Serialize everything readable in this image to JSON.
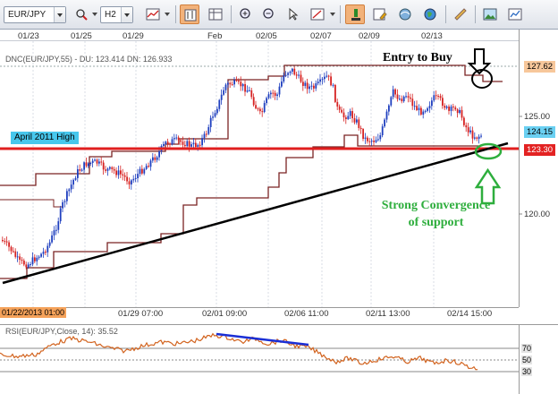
{
  "toolbar": {
    "symbol": "EUR/JPY",
    "timeframe": "H2",
    "icons": [
      "crosshair-zoom-icon",
      "bar-chart-icon",
      "candlestick-toggle-icon",
      "chart-table-icon",
      "zoom-in-icon",
      "zoom-out-icon",
      "cursor-icon",
      "drawing-icon",
      "edit-icon",
      "settings-icon",
      "globe-icon",
      "ruler-icon",
      "image-icon",
      "export-icon"
    ]
  },
  "chart": {
    "indicator_legend": "DNC(EUR/JPY,55) - DU: 123.414  DN: 126.933",
    "start_date": "01/22/2013 01:00",
    "top_dates": [
      "01/23",
      "01/25",
      "01/29",
      "Feb",
      "02/05",
      "02/07",
      "02/09",
      "02/13"
    ],
    "bottom_dates": [
      "01/29 07:00",
      "02/01 09:00",
      "02/06 11:00",
      "02/11 13:00",
      "02/14 15:00"
    ],
    "price_ticks": [
      "125.00",
      "120.00"
    ],
    "price_tags": {
      "top": "127.62",
      "current": "124.15",
      "support": "123.30"
    },
    "annotations": {
      "april_high": "April 2011 High",
      "entry": "Entry to Buy",
      "convergence_line1": "Strong Convergence",
      "convergence_line2": "of support"
    },
    "colors": {
      "support_line": "#e01f1f",
      "trend_line": "#000000",
      "channel": "#7b2323",
      "annotation_green": "#2eae3d",
      "rsi": "#d2631e"
    }
  },
  "rsi": {
    "legend": "RSI(EUR/JPY,Close, 14): 35.52",
    "ticks": [
      "70",
      "50",
      "30"
    ]
  }
}
